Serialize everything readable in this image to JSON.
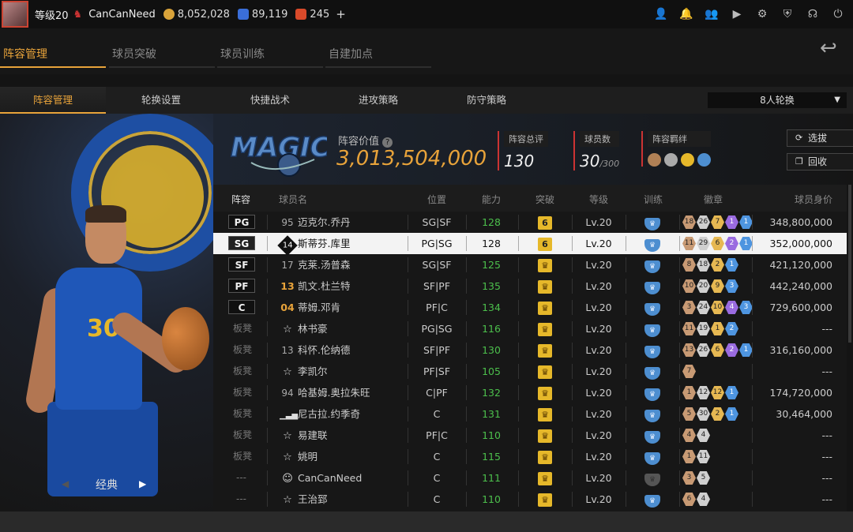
{
  "topbar": {
    "level": "等级20",
    "username": "CanCanNeed",
    "gold": "8,052,028",
    "stars": "89,119",
    "tickets": "245",
    "plus": "+",
    "icons": [
      "user-icon",
      "bell-icon",
      "friends-icon",
      "video-icon",
      "gear-icon",
      "shield-check-icon",
      "headset-icon",
      "power-icon"
    ]
  },
  "mainnav": [
    "阵容管理",
    "球员突破",
    "球员训练",
    "自建加点"
  ],
  "subnav": [
    "阵容管理",
    "轮换设置",
    "快捷战术",
    "进攻策略",
    "防守策略"
  ],
  "rotation": "8人轮换",
  "left": {
    "style": "经典"
  },
  "team": {
    "value_label": "阵容价值",
    "value": "3,013,504,000",
    "rating_label": "阵容总评",
    "rating": "130",
    "count_label": "球员数",
    "count": "30",
    "count_max": "/300",
    "bond_label": "阵容羁绊",
    "btn_select": "选拔",
    "btn_recycle": "回收"
  },
  "columns": [
    "阵容",
    "球员名",
    "位置",
    "能力",
    "突破",
    "等级",
    "训练",
    "徽章",
    "球员身价"
  ],
  "colors": {
    "accent": "#e8a33a",
    "green": "#4cbf4c",
    "shield": "#4d8ed0"
  },
  "rows": [
    {
      "slot": "PG",
      "starter": true,
      "num": "95",
      "numtype": "plain",
      "name": "迈克尔.乔丹",
      "pos": "SG|SF",
      "ovr": "128",
      "brk": "6",
      "lvl": "Lv.20",
      "train": true,
      "badges": [
        [
          "br",
          "18"
        ],
        [
          "sv",
          "26"
        ],
        [
          "gd",
          "7"
        ],
        [
          "pu",
          "1"
        ],
        [
          "bl",
          "1"
        ]
      ],
      "value": "348,800,000"
    },
    {
      "slot": "SG",
      "starter": true,
      "sel": true,
      "num": "14",
      "numtype": "diamond",
      "name": "斯蒂芬.库里",
      "pos": "PG|SG",
      "ovr": "128",
      "brk": "6",
      "lvl": "Lv.20",
      "train": true,
      "badges": [
        [
          "br",
          "11"
        ],
        [
          "sv",
          "29"
        ],
        [
          "gd",
          "6"
        ],
        [
          "pu",
          "2"
        ],
        [
          "bl",
          "1"
        ]
      ],
      "value": "352,000,000"
    },
    {
      "slot": "SF",
      "starter": true,
      "num": "17",
      "numtype": "plain",
      "name": "克莱.汤普森",
      "pos": "SG|SF",
      "ovr": "125",
      "brk": "♛",
      "lvl": "Lv.20",
      "train": true,
      "badges": [
        [
          "br",
          "8"
        ],
        [
          "sv",
          "18"
        ],
        [
          "gd",
          "2"
        ],
        [
          "bl",
          "1"
        ]
      ],
      "value": "421,120,000"
    },
    {
      "slot": "PF",
      "starter": true,
      "num": "13",
      "numtype": "gold",
      "name": "凯文.杜兰特",
      "pos": "SF|PF",
      "ovr": "135",
      "brk": "♛",
      "lvl": "Lv.20",
      "train": true,
      "badges": [
        [
          "br",
          "10"
        ],
        [
          "sv",
          "20"
        ],
        [
          "gd",
          "9"
        ],
        [
          "bl",
          "3"
        ]
      ],
      "value": "442,240,000"
    },
    {
      "slot": "C",
      "starter": true,
      "num": "04",
      "numtype": "gold",
      "name": "蒂姆.邓肯",
      "pos": "PF|C",
      "ovr": "134",
      "brk": "♛",
      "lvl": "Lv.20",
      "train": true,
      "badges": [
        [
          "br",
          "3"
        ],
        [
          "sv",
          "24"
        ],
        [
          "gd",
          "10"
        ],
        [
          "pu",
          "4"
        ],
        [
          "bl",
          "3"
        ]
      ],
      "value": "729,600,000"
    },
    {
      "slot": "板凳",
      "num": "☆",
      "numtype": "star",
      "name": "林书豪",
      "pos": "PG|SG",
      "ovr": "116",
      "brk": "♛",
      "lvl": "Lv.20",
      "train": true,
      "badges": [
        [
          "br",
          "11"
        ],
        [
          "sv",
          "19"
        ],
        [
          "gd",
          "1"
        ],
        [
          "bl",
          "2"
        ]
      ],
      "value": "---"
    },
    {
      "slot": "板凳",
      "num": "13",
      "numtype": "plain",
      "name": "科怀.伦纳德",
      "pos": "SF|PF",
      "ovr": "130",
      "brk": "♛",
      "lvl": "Lv.20",
      "train": true,
      "badges": [
        [
          "br",
          "13"
        ],
        [
          "sv",
          "26"
        ],
        [
          "gd",
          "6"
        ],
        [
          "pu",
          "2"
        ],
        [
          "bl",
          "1"
        ]
      ],
      "value": "316,160,000"
    },
    {
      "slot": "板凳",
      "num": "☆",
      "numtype": "star",
      "name": "李凯尔",
      "pos": "PF|SF",
      "ovr": "105",
      "brk": "♛",
      "lvl": "Lv.20",
      "train": true,
      "badges": [
        [
          "br",
          "7"
        ]
      ],
      "value": "---"
    },
    {
      "slot": "板凳",
      "num": "94",
      "numtype": "plain",
      "name": "哈基姆.奥拉朱旺",
      "pos": "C|PF",
      "ovr": "132",
      "brk": "♛",
      "lvl": "Lv.20",
      "train": true,
      "badges": [
        [
          "br",
          "1"
        ],
        [
          "sv",
          "12"
        ],
        [
          "gd",
          "12"
        ],
        [
          "bl",
          "1"
        ]
      ],
      "value": "174,720,000"
    },
    {
      "slot": "板凳",
      "num": "▮",
      "numtype": "bars",
      "name": "尼古拉.约季奇",
      "pos": "C",
      "ovr": "131",
      "brk": "♛",
      "lvl": "Lv.20",
      "train": true,
      "badges": [
        [
          "br",
          "5"
        ],
        [
          "sv",
          "30"
        ],
        [
          "gd",
          "2"
        ],
        [
          "bl",
          "1"
        ]
      ],
      "value": "30,464,000"
    },
    {
      "slot": "板凳",
      "num": "☆",
      "numtype": "star",
      "name": "易建联",
      "pos": "PF|C",
      "ovr": "110",
      "brk": "♛",
      "lvl": "Lv.20",
      "train": true,
      "badges": [
        [
          "br",
          "4"
        ],
        [
          "sv",
          "4"
        ]
      ],
      "value": "---"
    },
    {
      "slot": "板凳",
      "num": "☆",
      "numtype": "star",
      "name": "姚明",
      "pos": "C",
      "ovr": "115",
      "brk": "♛",
      "lvl": "Lv.20",
      "train": true,
      "badges": [
        [
          "br",
          "1"
        ],
        [
          "sv",
          "11"
        ]
      ],
      "value": "---"
    },
    {
      "slot": "---",
      "num": "☺",
      "numtype": "person",
      "name": "CanCanNeed",
      "pos": "C",
      "ovr": "111",
      "brk": "♛",
      "lvl": "Lv.20",
      "train": false,
      "badges": [
        [
          "br",
          "3"
        ],
        [
          "sv",
          "5"
        ]
      ],
      "value": "---"
    },
    {
      "slot": "---",
      "num": "☆",
      "numtype": "star",
      "name": "王治郅",
      "pos": "C",
      "ovr": "110",
      "brk": "♛",
      "lvl": "Lv.20",
      "train": true,
      "badges": [
        [
          "br",
          "6"
        ],
        [
          "sv",
          "4"
        ]
      ],
      "value": "---"
    }
  ]
}
